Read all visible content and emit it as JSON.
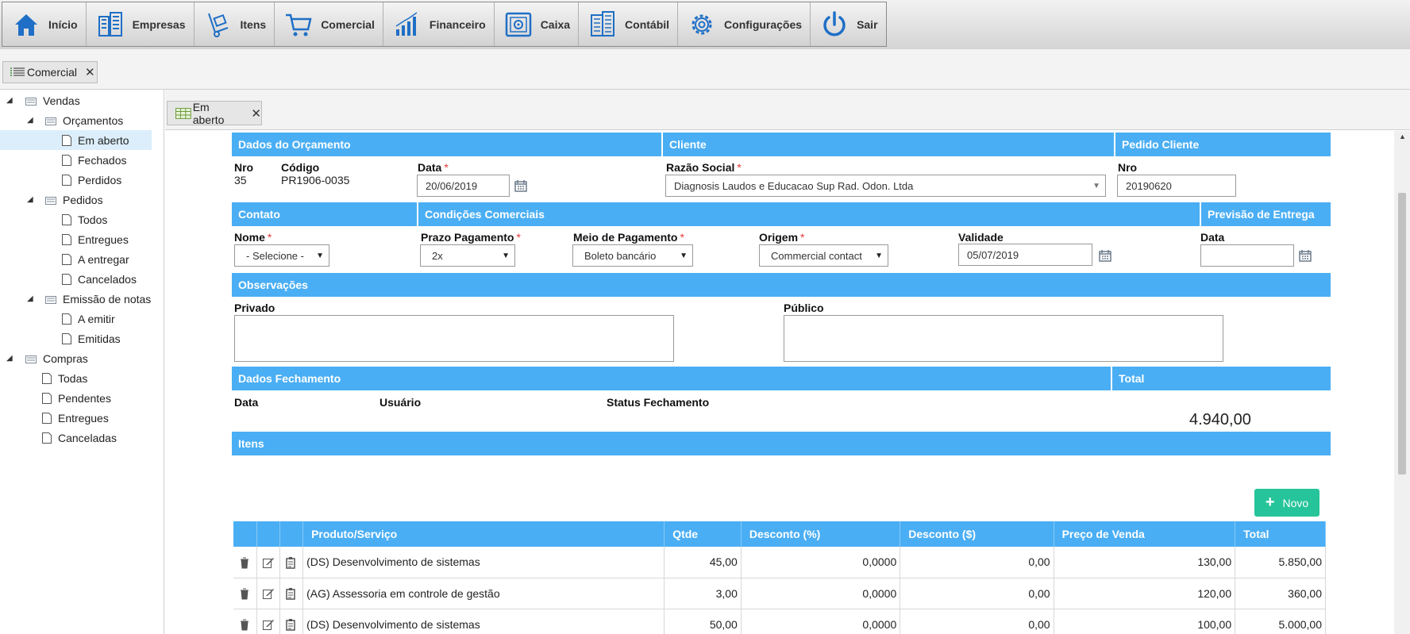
{
  "nav": {
    "items": [
      {
        "label": "Início",
        "icon": "home-icon"
      },
      {
        "label": "Empresas",
        "icon": "buildings-icon"
      },
      {
        "label": "Itens",
        "icon": "hand-truck-icon"
      },
      {
        "label": "Comercial",
        "icon": "cart-icon"
      },
      {
        "label": "Financeiro",
        "icon": "bar-chart-icon"
      },
      {
        "label": "Caixa",
        "icon": "safe-icon"
      },
      {
        "label": "Contábil",
        "icon": "calculator-icon"
      },
      {
        "label": "Configurações",
        "icon": "gear-icon"
      },
      {
        "label": "Sair",
        "icon": "power-icon"
      }
    ]
  },
  "module_tab": {
    "label": "Comercial"
  },
  "content_tab": {
    "label": "Em aberto"
  },
  "tree": {
    "vendas": "Vendas",
    "orcamentos": "Orçamentos",
    "em_aberto": "Em aberto",
    "fechados": "Fechados",
    "perdidos": "Perdidos",
    "pedidos": "Pedidos",
    "todos": "Todos",
    "entregues": "Entregues",
    "a_entregar": "A entregar",
    "cancelados": "Cancelados",
    "emissao": "Emissão de notas",
    "a_emitir": "A emitir",
    "emitidas": "Emitidas",
    "compras": "Compras",
    "todas": "Todas",
    "pendentes": "Pendentes",
    "entregues_c": "Entregues",
    "canceladas": "Canceladas"
  },
  "form": {
    "dados_orcamento": "Dados do Orçamento",
    "cliente": "Cliente",
    "pedido_cliente": "Pedido Cliente",
    "nro_label": "Nro",
    "nro_value": "35",
    "codigo_label": "Código",
    "codigo_value": "PR1906-0035",
    "data_label": "Data",
    "data_value": "20/06/2019",
    "razao_label": "Razão Social",
    "razao_value": "Diagnosis Laudos e Educacao Sup Rad. Odon. Ltda",
    "pedido_nro_label": "Nro",
    "pedido_nro_value": "20190620",
    "contato": "Contato",
    "condicoes": "Condições Comerciais",
    "previsao": "Previsão de Entrega",
    "nome_label": "Nome",
    "nome_value": "- Selecione -",
    "prazo_label": "Prazo Pagamento",
    "prazo_value": "2x",
    "meio_label": "Meio de Pagamento",
    "meio_value": "Boleto bancário",
    "origem_label": "Origem",
    "origem_value": "Commercial contact",
    "validade_label": "Validade",
    "validade_value": "05/07/2019",
    "prev_data_label": "Data",
    "prev_data_value": "",
    "observacoes": "Observações",
    "privado_label": "Privado",
    "publico_label": "Público",
    "dados_fechamento": "Dados Fechamento",
    "total_header": "Total",
    "fech_data_label": "Data",
    "fech_usuario_label": "Usuário",
    "fech_status_label": "Status Fechamento",
    "total_value": "4.940,00",
    "itens": "Itens",
    "novo_label": "Novo"
  },
  "table": {
    "headers": [
      "Produto/Serviço",
      "Qtde",
      "Desconto (%)",
      "Desconto ($)",
      "Preço de Venda",
      "Total"
    ],
    "rows": [
      {
        "produto": "(DS) Desenvolvimento de sistemas",
        "qtde": "45,00",
        "desc_pct": "0,0000",
        "desc_val": "0,00",
        "preco": "130,00",
        "total": "5.850,00"
      },
      {
        "produto": "(AG) Assessoria em controle de gestão",
        "qtde": "3,00",
        "desc_pct": "0,0000",
        "desc_val": "0,00",
        "preco": "120,00",
        "total": "360,00"
      },
      {
        "produto": "(DS) Desenvolvimento de sistemas",
        "qtde": "50,00",
        "desc_pct": "0,0000",
        "desc_val": "0,00",
        "preco": "100,00",
        "total": "5.000,00"
      }
    ]
  },
  "colors": {
    "accent": "#4aaef4",
    "success": "#26c49a",
    "selected": "#dceefb",
    "nav_icon": "#1f6fc6"
  }
}
